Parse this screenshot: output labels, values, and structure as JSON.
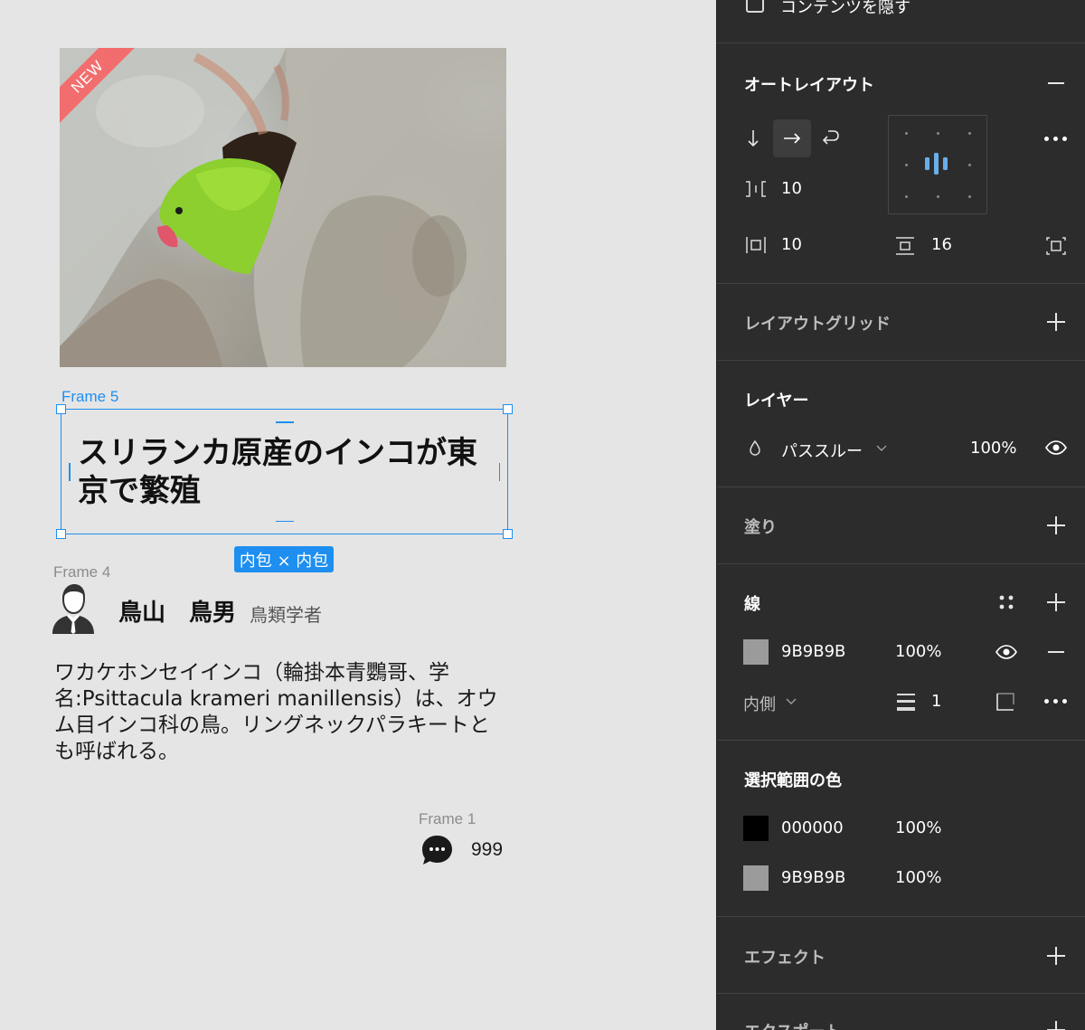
{
  "canvas": {
    "ribbon_text": "NEW",
    "frame5_label": "Frame 5",
    "headline": "スリランカ原産のインコが東京で繁殖",
    "size_badge": "内包 × 内包",
    "frame4_label": "Frame 4",
    "author_name": "鳥山　鳥男",
    "author_role": "鳥類学者",
    "body": "ワカケホンセイインコ（輪掛本青鸚哥、学名:Psittacula krameri manillensis）は、オウム目インコ科の鳥。リングネックパラキートとも呼ばれる。",
    "frame1_label": "Frame 1",
    "comment_count": "999",
    "colors": {
      "selection": "#1e8ff0",
      "ribbon": "#f26d6d"
    }
  },
  "panel": {
    "hide_content_label": "コンテンツを隠す",
    "auto_layout": {
      "title": "オートレイアウト",
      "spacing": "10",
      "padding_horizontal": "10",
      "padding_vertical": "16"
    },
    "layout_grid": {
      "title": "レイアウトグリッド"
    },
    "layer": {
      "title": "レイヤー",
      "blend_mode": "パススルー",
      "opacity": "100%"
    },
    "fill": {
      "title": "塗り"
    },
    "stroke": {
      "title": "線",
      "color_hex": "9B9B9B",
      "opacity": "100%",
      "position": "内側",
      "weight": "1"
    },
    "selection_colors": {
      "title": "選択範囲の色",
      "items": [
        {
          "hex": "000000",
          "opacity": "100%",
          "swatch": "#000000"
        },
        {
          "hex": "9B9B9B",
          "opacity": "100%",
          "swatch": "#9b9b9b"
        }
      ]
    },
    "effects": {
      "title": "エフェクト"
    },
    "export": {
      "title": "エクスポート"
    },
    "colors": {
      "background": "#2c2c2c",
      "accent": "#1e8ff0"
    }
  }
}
